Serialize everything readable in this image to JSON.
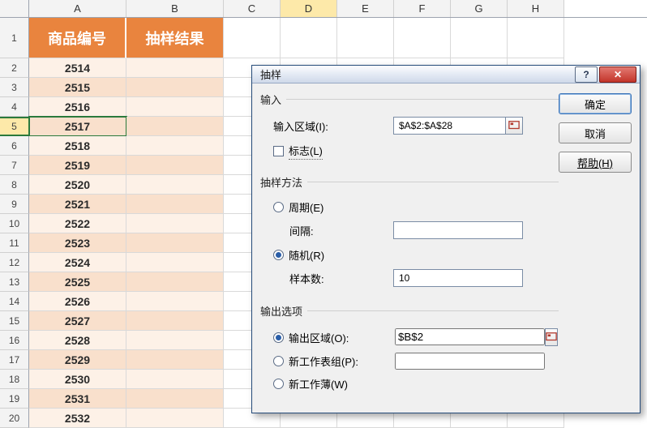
{
  "sheet": {
    "columns": [
      "A",
      "B",
      "C",
      "D",
      "E",
      "F",
      "G",
      "H"
    ],
    "selected_column": "D",
    "selected_row": 5,
    "header_row": {
      "colA": "商品编号",
      "colB": "抽样结果"
    },
    "row_numbers": [
      1,
      2,
      3,
      4,
      5,
      6,
      7,
      8,
      9,
      10,
      11,
      12,
      13,
      14,
      15,
      16,
      17,
      18,
      19,
      20
    ],
    "data_rows": [
      {
        "rownum": 2,
        "A": "2514"
      },
      {
        "rownum": 3,
        "A": "2515"
      },
      {
        "rownum": 4,
        "A": "2516"
      },
      {
        "rownum": 5,
        "A": "2517"
      },
      {
        "rownum": 6,
        "A": "2518"
      },
      {
        "rownum": 7,
        "A": "2519"
      },
      {
        "rownum": 8,
        "A": "2520"
      },
      {
        "rownum": 9,
        "A": "2521"
      },
      {
        "rownum": 10,
        "A": "2522"
      },
      {
        "rownum": 11,
        "A": "2523"
      },
      {
        "rownum": 12,
        "A": "2524"
      },
      {
        "rownum": 13,
        "A": "2525"
      },
      {
        "rownum": 14,
        "A": "2526"
      },
      {
        "rownum": 15,
        "A": "2527"
      },
      {
        "rownum": 16,
        "A": "2528"
      },
      {
        "rownum": 17,
        "A": "2529"
      },
      {
        "rownum": 18,
        "A": "2530"
      },
      {
        "rownum": 19,
        "A": "2531"
      },
      {
        "rownum": 20,
        "A": "2532"
      }
    ]
  },
  "dialog": {
    "title": "抽样",
    "buttons": {
      "ok": "确定",
      "cancel": "取消",
      "help": "帮助(H)"
    },
    "groups": {
      "input": {
        "legend": "输入",
        "input_range_label": "输入区域(I):",
        "input_range_value": "$A$2:$A$28",
        "labels_checkbox": "标志(L)",
        "labels_checked": false
      },
      "method": {
        "legend": "抽样方法",
        "period_label": "周期(E)",
        "interval_label": "间隔:",
        "interval_value": "",
        "random_label": "随机(R)",
        "sample_count_label": "样本数:",
        "sample_count_value": "10",
        "selected": "random"
      },
      "output": {
        "legend": "输出选项",
        "output_range_label": "输出区域(O):",
        "output_range_value": "$B$2",
        "new_worksheet_label": "新工作表组(P):",
        "new_worksheet_value": "",
        "new_workbook_label": "新工作薄(W)",
        "selected": "output_range"
      }
    }
  }
}
